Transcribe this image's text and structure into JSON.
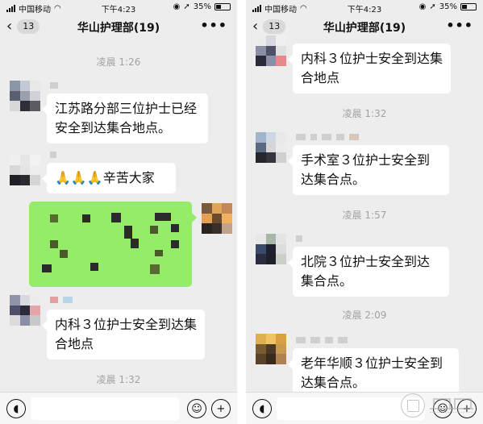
{
  "status_bar": {
    "carrier": "中国移动",
    "time": "下午4:23",
    "battery": "35%"
  },
  "header": {
    "back_count": "13",
    "title": "华山护理部(19)",
    "more": "•••"
  },
  "left": {
    "timestamps": [
      "凌晨 1:26",
      "凌晨 1:32"
    ],
    "messages": [
      {
        "sender": "incoming",
        "text": "江苏路分部三位护士已经安全到达集合地点。"
      },
      {
        "sender": "incoming",
        "text": "🙏🙏🙏辛苦大家"
      },
      {
        "sender": "outgoing",
        "text": ""
      },
      {
        "sender": "incoming",
        "text": "内科３位护士安全到达集合地点"
      }
    ]
  },
  "right": {
    "timestamps": [
      "凌晨 1:32",
      "凌晨 1:57",
      "凌晨 2:09"
    ],
    "messages": [
      {
        "sender": "incoming",
        "text": "内科３位护士安全到达集合地点"
      },
      {
        "sender": "incoming",
        "text": "手术室３位护士安全到达集合点。"
      },
      {
        "sender": "incoming",
        "text": "北院３位护士安全到达集合点。"
      },
      {
        "sender": "incoming",
        "text": "老年华顺３位护士安全到达集合点。"
      }
    ]
  },
  "input_bar": {
    "voice_icon": "voice-icon",
    "emoji_icon": "emoji-icon",
    "plus_icon": "plus-icon"
  },
  "watermark": {
    "name": "复旦大学",
    "latin": "FUDAN UNIVERSITY"
  },
  "colors": {
    "background": "#ededed",
    "bubble_incoming": "#ffffff",
    "bubble_outgoing": "#95ec69",
    "timestamp": "#a3a3a3"
  }
}
